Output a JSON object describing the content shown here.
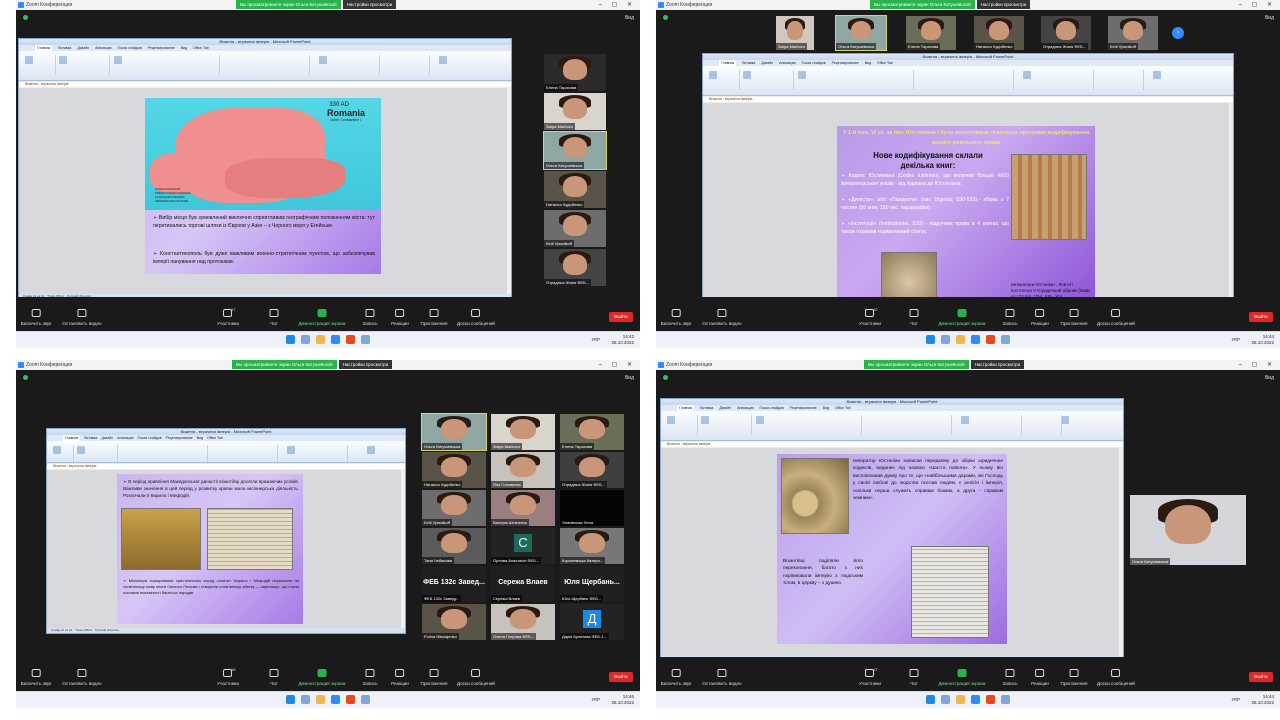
{
  "zoom": {
    "window_title": "Zoom Конференция",
    "share_banner": "Вы просматриваете экран Ольги Катушевской",
    "view_options": "Настройки просмотра",
    "view": "Вид",
    "leave": "Выйти",
    "toolbar": {
      "mute": "Включить звук",
      "video": "Остановить видео",
      "participants": "Участники",
      "chat": "Чат",
      "share": "Демонстрация экрана",
      "record": "Запись",
      "reactions": "Реакции",
      "apps": "Приложения",
      "whiteboard": "Доски сообщений"
    }
  },
  "ppt": {
    "title": "Візантія - втрачена імперія - Microsoft PowerPoint",
    "tabs": [
      "Главная",
      "Вставка",
      "Дизайн",
      "Анимация",
      "Показ слайдов",
      "Рецензирование",
      "Вид",
      "Office Tab"
    ],
    "doc_tab": "Візантія - втрачена імперія",
    "theme": "\"Тема Office\"",
    "lang": "Русский (Россия)"
  },
  "system": {
    "lang": "УКР",
    "date": "28.10.2022"
  },
  "q1": {
    "participants_count": "17",
    "time": "14:42",
    "slide_status": "Слайд 14 из 44",
    "map_labels": {
      "year": "330 AD",
      "title": "Romania",
      "subtitle": "under Constantine I"
    },
    "legend": [
      "ROMAN FRONTIERS",
      "PREFECTURE BOUNDARIES",
      "DIOCESE BOUNDARIES",
      "DEPENDENCIES OF ROME"
    ],
    "bullet1": "➢ Вибір місця був зумовлений виключно сприятливим географічним положенням міста: тут перетинались торгові шляхи із Європи у Азію – з Чорного моря у Егейське.",
    "bullet2": "➢ Константинополь був дуже важливим военно-стратегічним пунктом, що забезпечував імперії панування над протоками.",
    "participants": [
      "Елена Тарасова",
      "Зміра Markozo",
      "Ольга Катушевська",
      "Наталья Худобенко",
      "Kirill Vjasnikoff",
      "Отрадных Жаня ФЕБ..."
    ]
  },
  "q2": {
    "participants_count": "10",
    "time": "14:44",
    "heading": "У 1-й пол. VI ст. за імп. Юстиніана I була реалізована гігантська програма кодифікування всього римського права",
    "title": "Нове кодифікування склали декілька книг:",
    "items": [
      "➢ Кодекс Юстиніана (Codex Iustinian), що включив більше 4600 імператорських указів - від Адріана до Юстиніана;",
      "➢ «Дигести», або «Пандекти» (лат. Digesta; 530-533),- збірка з 7 частин (50 книг, 150 тис. параграфів);",
      "➢ «Інституції» (Institutiones, 533) - підручник права в 4 книгах, що також отримав нормативний статус."
    ],
    "caption": "Імператори Юстиніан , Лев III і Костянтин V Юридичний збірник (Мавс от 172 Fol. 27v). XIII - XIV",
    "participants": [
      "Зміра Markozo",
      "Ольга Катушевська",
      "Елена Тарасова",
      "Наталья Худобенко",
      "Отрадных Жаня ФЕБ...",
      "Kirill Vjasnikoff"
    ]
  },
  "q3": {
    "participants_count": "18",
    "time": "14:46",
    "slide_status": "Слайд 22 из 44",
    "top_text": "➢ В період правління Македонської династії візантійці досягли вражаючих успіхів. Важливе значення в цей період у розвитку країни мала місіонерська діяльність. Розпочали її Кирило і Мефодій.",
    "bottom_text": "➢ Місіонери поширювали християнство серед слов'ян: Кирило і Мефодій переклали на слов'янську мову книги Святого Письма і створили слов'янську абетку — кирилицю, що стала основою писемності багатьох народів.",
    "participants": [
      {
        "name": "Ольга Катушевська",
        "kind": "video"
      },
      {
        "name": "Зміра Markozo",
        "kind": "video"
      },
      {
        "name": "Елена Тарасова",
        "kind": "video"
      },
      {
        "name": "Наталья Худобенко",
        "kind": "video"
      },
      {
        "name": "Яна Головатюк",
        "kind": "video"
      },
      {
        "name": "Отрадных Жаня ФЕБ...",
        "kind": "video"
      },
      {
        "name": "Kirill Vjasnikoff",
        "kind": "video"
      },
      {
        "name": "Валерія Шевченко",
        "kind": "video"
      },
      {
        "name": "Уманівська Лена",
        "kind": "dark"
      },
      {
        "name": "Таня Чебанова",
        "kind": "video"
      },
      {
        "name": "Орлова Анастасія ФЕБ...",
        "kind": "letter",
        "letter": "С"
      },
      {
        "name": "Королевська Катери...",
        "kind": "video"
      },
      {
        "name": "ФЕБ 132с Заведу...",
        "kind": "text",
        "big": "ФЕБ 132с Завед..."
      },
      {
        "name": "Сережа Влаєв",
        "kind": "text",
        "big": "Сережа Влаев"
      },
      {
        "name": "Юля Щербань ФЕБ...",
        "kind": "text",
        "big": "Юля Щербань..."
      },
      {
        "name": "Polina Nikolajenko",
        "kind": "video"
      },
      {
        "name": "Олена Гнерова ФЕБ...",
        "kind": "video"
      },
      {
        "name": "Дарія Булатова ФЕБ-1...",
        "kind": "letter",
        "letter": "Д"
      }
    ]
  },
  "q4": {
    "participants_count": "17",
    "time": "14:44",
    "slide_status": "Слайд 27 из 44",
    "text1": "Імператор Юстиніан написав передмову до збірки юридичних кодексів, виданих під назвою «Шоста новела». У ньому він висловлював думку про те, що «найбільшими дарами, які Господь у своїй любові до людства послав людям, є релігія і імперія, оскільки перша служить справам божим, а друга - справам земним».",
    "text2": "Візантійці поділяли його переконання, багато з них порівнювали імперію з людським тілом, в церкву – з душею.",
    "participant": "Ольга Катушевська"
  }
}
